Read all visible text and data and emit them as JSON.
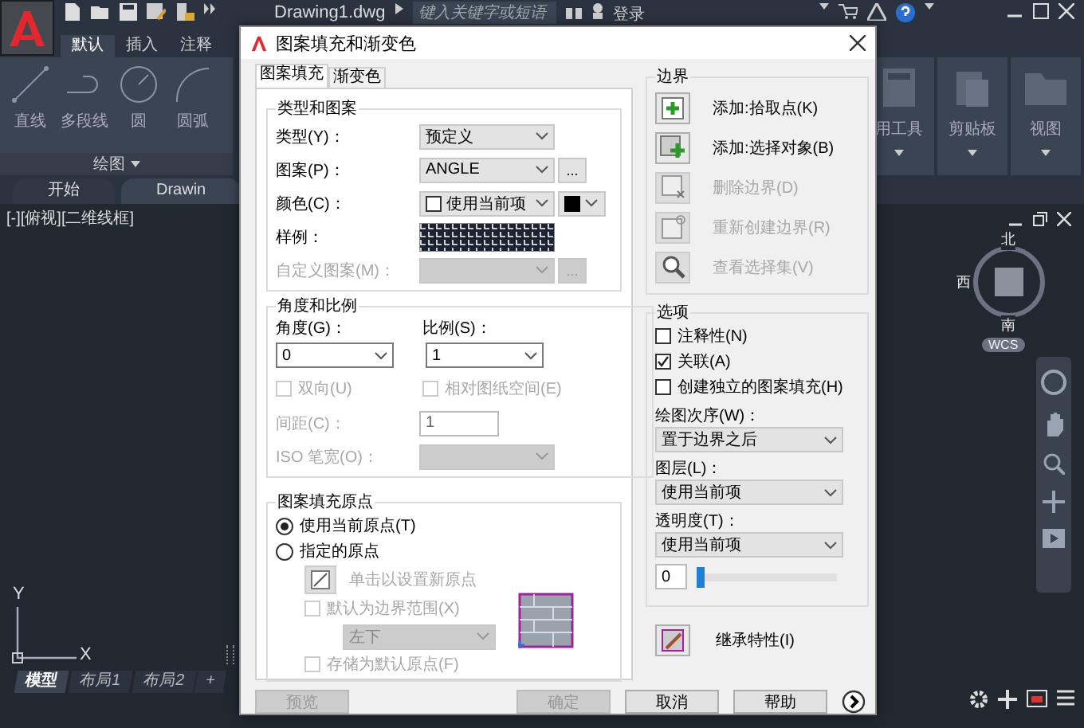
{
  "app": {
    "document_title": "Drawing1.dwg",
    "search": {
      "placeholder": "键入关键字或短语"
    },
    "sign_in": "登录",
    "ribbon_tabs": [
      {
        "label": "默认",
        "selected": true
      },
      {
        "label": "插入",
        "selected": false
      },
      {
        "label": "注释",
        "selected": false
      }
    ],
    "draw_tools": [
      {
        "label": "直线",
        "kind": "line"
      },
      {
        "label": "多段线",
        "kind": "polyline"
      },
      {
        "label": "圆",
        "kind": "circle"
      },
      {
        "label": "圆弧",
        "kind": "arc"
      }
    ],
    "draw_panel": "绘图",
    "right_panels": [
      {
        "label": "用工具",
        "kind": "calculator"
      },
      {
        "label": "剪贴板",
        "kind": "clipboard"
      },
      {
        "label": "视图",
        "kind": "view"
      }
    ],
    "file_tabs": [
      {
        "label": "开始",
        "selected": false
      },
      {
        "label": "Drawin",
        "selected": true
      }
    ],
    "viewport_label": "[-][俯视][二维线框]",
    "viewcube": {
      "north": "北",
      "west": "西",
      "south": "南",
      "wcs": "WCS"
    },
    "ucs": {
      "x": "X",
      "y": "Y"
    },
    "layout_tabs": [
      {
        "label": "模型",
        "selected": true
      },
      {
        "label": "布局1",
        "selected": false
      },
      {
        "label": "布局2",
        "selected": false
      }
    ],
    "add_layout": "+"
  },
  "dialog": {
    "title": "图案填充和渐变色",
    "tabs": [
      {
        "label": "图案填充",
        "selected": true
      },
      {
        "label": "渐变色",
        "selected": false
      }
    ],
    "type_group": {
      "title": "类型和图案",
      "rows": [
        {
          "kind": "select",
          "label": "类型(Y)：",
          "value": "预定义",
          "disabled": false
        },
        {
          "kind": "select",
          "label": "图案(P)：",
          "value": "ANGLE",
          "disabled": false,
          "button": "..."
        },
        {
          "kind": "color",
          "label": "颜色(C)：",
          "value": "使用当前项",
          "disabled": false
        },
        {
          "kind": "sample",
          "label": "样例：",
          "disabled": false
        },
        {
          "kind": "select",
          "label": "自定义图案(M)：",
          "disabled": true,
          "button": "..."
        }
      ]
    },
    "angle_group": {
      "title": "角度和比例",
      "angle": {
        "label": "角度(G)：",
        "value": "0"
      },
      "scale": {
        "label": "比例(S)：",
        "value": "1"
      },
      "checks": [
        {
          "label": "双向(U)",
          "checked": false,
          "disabled": true
        },
        {
          "label": "相对图纸空间(E)",
          "checked": false,
          "disabled": true
        }
      ],
      "spacing": {
        "label": "间距(C)：",
        "value": "1",
        "disabled": true
      },
      "iso": {
        "label": "ISO 笔宽(O)：",
        "disabled": true
      }
    },
    "origin_group": {
      "title": "图案填充原点",
      "radios": [
        {
          "label": "使用当前原点(T)",
          "selected": true
        },
        {
          "label": "指定的原点",
          "selected": false
        }
      ],
      "set_origin": {
        "label": "单击以设置新原点",
        "disabled": true
      },
      "checks": [
        {
          "label": "默认为边界范围(X)",
          "checked": false,
          "disabled": true
        },
        {
          "label": "存储为默认原点(F)",
          "checked": false,
          "disabled": true
        }
      ],
      "position": {
        "value": "左下",
        "disabled": true
      }
    },
    "boundary": {
      "title": "边界",
      "buttons": [
        {
          "label": "添加:拾取点(K)",
          "disabled": false,
          "kind": "pick"
        },
        {
          "label": "添加:选择对象(B)",
          "disabled": false,
          "kind": "select"
        },
        {
          "label": "删除边界(D)",
          "disabled": true,
          "kind": "remove"
        },
        {
          "label": "重新创建边界(R)",
          "disabled": true,
          "kind": "recreate"
        },
        {
          "label": "查看选择集(V)",
          "disabled": true,
          "kind": "view"
        }
      ]
    },
    "options": {
      "title": "选项",
      "checks": [
        {
          "label": "注释性(N)",
          "checked": false
        },
        {
          "label": "关联(A)",
          "checked": true
        },
        {
          "label": "创建独立的图案填充(H)",
          "checked": false
        }
      ],
      "selects": [
        {
          "label": "绘图次序(W)：",
          "value": "置于边界之后"
        },
        {
          "label": "图层(L)：",
          "value": "使用当前项"
        },
        {
          "label": "透明度(T)：",
          "value": "使用当前项"
        }
      ],
      "transparency": {
        "value": "0",
        "level": 0
      }
    },
    "inherit": "继承特性(I)",
    "buttons": [
      {
        "label": "预览",
        "disabled": true
      },
      {
        "label": "确定",
        "disabled": true
      },
      {
        "label": "取消",
        "disabled": false
      },
      {
        "label": "帮助",
        "disabled": false
      }
    ]
  }
}
